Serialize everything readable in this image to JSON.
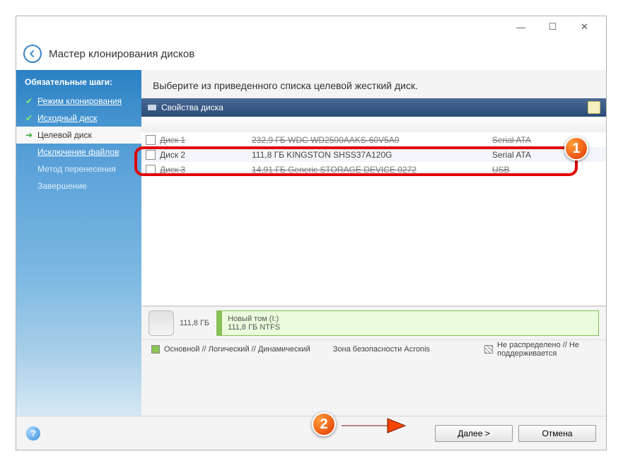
{
  "titlebar": {
    "minimize": "—",
    "maximize": "☐",
    "close": "✕"
  },
  "wizard_title": "Мастер клонирования дисков",
  "sidebar": {
    "heading": "Обязательные шаги:",
    "steps": [
      {
        "label": "Режим клонирования",
        "status": "done"
      },
      {
        "label": "Исходный диск",
        "status": "done"
      },
      {
        "label": "Целевой диск",
        "status": "active"
      },
      {
        "label": "Исключение файлов",
        "status": "link"
      },
      {
        "label": "Метод перенесения",
        "status": "dim"
      },
      {
        "label": "Завершение",
        "status": "dim"
      }
    ]
  },
  "instruction": "Выберите из приведенного списка целевой жесткий диск.",
  "panel": {
    "title": "Свойства диска"
  },
  "disks": [
    {
      "name": "Диск 1",
      "capacity": "232,9 ГБ WDC WD2500AAKS-60V5A0",
      "iface": "Serial ATA",
      "state": "struck"
    },
    {
      "name": "Диск 2",
      "capacity": "111,8 ГБ KINGSTON SHSS37A120G",
      "iface": "Serial ATA",
      "state": "selected"
    },
    {
      "name": "Диск 3",
      "capacity": "14,91 ГБ Generic STORAGE DEVICE 0272",
      "iface": "USB",
      "state": "struck"
    }
  ],
  "summary": {
    "size": "111,8 ГБ",
    "vol_name": "Новый том (I:)",
    "vol_detail": "111,8 ГБ NTFS"
  },
  "legend": {
    "left": "Основной // Логический // Динамический",
    "mid": "Зона безопасности Acronis",
    "right": "Не распределено // Не поддерживается"
  },
  "buttons": {
    "next": "Далее >",
    "cancel": "Отмена"
  },
  "badges": {
    "one": "1",
    "two": "2"
  }
}
